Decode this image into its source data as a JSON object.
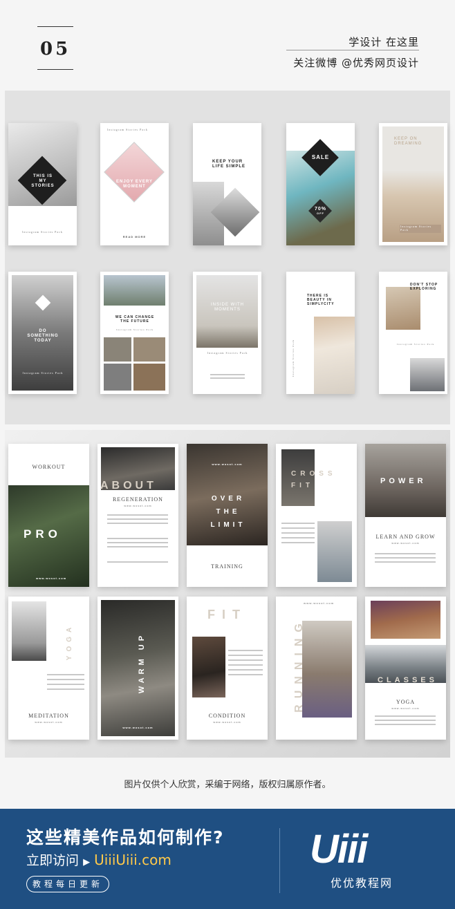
{
  "header": {
    "number": "05",
    "line1": "学设计 在这里",
    "line2": "关注微博 @优秀网页设计"
  },
  "templates_a": [
    {
      "text": "THIS IS MY STORIES",
      "caption": "Instagram Stories Pack"
    },
    {
      "text": "ENJOY EVERY MOMENT",
      "caption": "Instagram Stories Pack",
      "footer": "READ MORE"
    },
    {
      "text": "KEEP YOUR LIFE SIMPLE"
    },
    {
      "text": "SALE",
      "sub": "70%",
      "sub2": "OFF"
    },
    {
      "text": "KEEP ON DREAMING",
      "caption": "Instagram Stories Pack"
    },
    {
      "text": "DO SOMETHING TODAY",
      "caption": "Instagram Stories Pack"
    },
    {
      "text": "WE CAN CHANGE THE FUTURE",
      "caption": "Instagram Stories Pack"
    },
    {
      "text": "INSIDE WITH MOMENTS",
      "caption": "Instagram Stories Pack"
    },
    {
      "text": "THERE IS BEAUTY IN SIMPLYCITY",
      "caption": "Instagram Stories Pack"
    },
    {
      "text": "DON'T STOP EXPLORING",
      "caption": "Instagram Stories Pack"
    }
  ],
  "templates_b": [
    {
      "top": "WORKOUT",
      "big": "PRO",
      "url": "www.wosot.com"
    },
    {
      "big": "ABOUT",
      "title": "REGENERATION",
      "url": "www.wosot.com"
    },
    {
      "big": "OVER THE LIMIT",
      "title": "TRAINING",
      "url": "www.wosot.com"
    },
    {
      "big": "CROSS FIT"
    },
    {
      "big": "POWER",
      "title": "LEARN AND GROW",
      "url": "www.wosot.com"
    },
    {
      "big": "YOGA",
      "title": "MEDITATION",
      "url": "www.wosot.com"
    },
    {
      "big": "WARM UP",
      "url": "www.wosot.com"
    },
    {
      "big": "FIT",
      "title": "CONDITION",
      "url": "www.wosot.com"
    },
    {
      "big": "RUNNING",
      "url": "www.wosot.com"
    },
    {
      "big": "CLASSES",
      "title": "YOGA",
      "url": "www.wosot.com"
    }
  ],
  "note": "图片仅供个人欣赏，采编于网络，版权归属原作者。",
  "footer": {
    "title": "这些精美作品如何制作?",
    "visit_label": "立即访问",
    "url": "UiiiUiii.com",
    "pill": "教程每日更新",
    "logo": "Uiii",
    "logo_sub": "优优教程网"
  },
  "colors": {
    "footer_bg": "#1f4f82",
    "url_color": "#ffc94a"
  }
}
